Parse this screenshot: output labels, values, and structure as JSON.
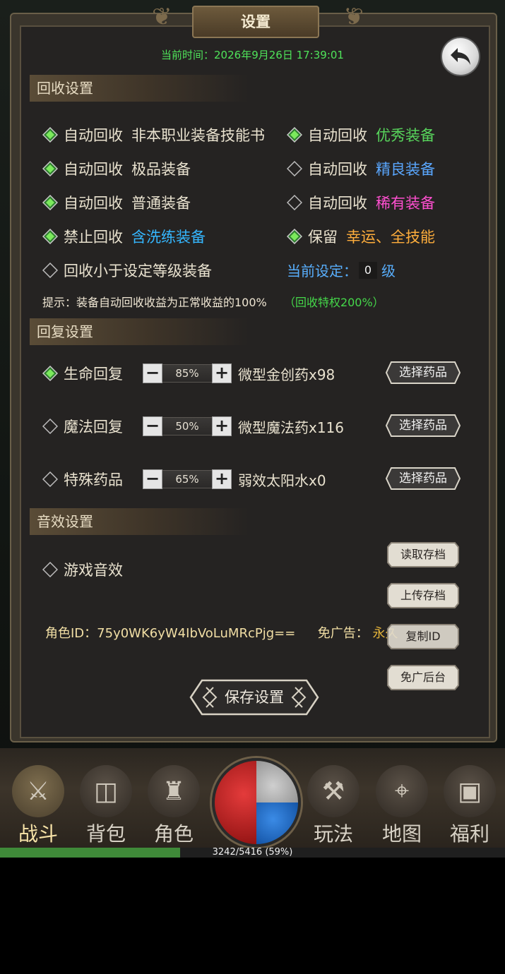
{
  "header": {
    "title": "设置",
    "current_time": "当前时间：2026年9月26日  17:39:01"
  },
  "recycle": {
    "section_title": "回收设置",
    "rows": [
      {
        "prefix": "自动回收",
        "item": "非本职业装备技能书",
        "checked": true,
        "color": "#e9e2cf"
      },
      {
        "prefix": "自动回收",
        "item": "优秀装备",
        "checked": true,
        "color": "#58d55c"
      },
      {
        "prefix": "自动回收",
        "item": "极品装备",
        "checked": true,
        "color": "#e9e2cf"
      },
      {
        "prefix": "自动回收",
        "item": "精良装备",
        "checked": false,
        "color": "#5aa7ff"
      },
      {
        "prefix": "自动回收",
        "item": "普通装备",
        "checked": true,
        "color": "#e9e2cf"
      },
      {
        "prefix": "自动回收",
        "item": "稀有装备",
        "checked": false,
        "color": "#ff4fd0"
      },
      {
        "prefix": "禁止回收",
        "item": "含洗练装备",
        "checked": true,
        "color": "#35b7ff"
      },
      {
        "prefix": "保留",
        "item": "幸运、全技能",
        "checked": true,
        "color": "#ffae3c"
      }
    ],
    "level_label": "回收小于设定等级装备",
    "level_checked": false,
    "current_setting_label": "当前设定：",
    "current_level": "0",
    "level_unit": "级",
    "hint": "提示：装备自动回收收益为正常收益的100%",
    "privilege": "（回收特权200%）"
  },
  "recovery": {
    "section_title": "回复设置",
    "rows": [
      {
        "label": "生命回复",
        "checked": true,
        "percent": "85%",
        "medicine": "微型金创药x98",
        "button": "选择药品"
      },
      {
        "label": "魔法回复",
        "checked": false,
        "percent": "50%",
        "medicine": "微型魔法药x116",
        "button": "选择药品"
      },
      {
        "label": "特殊药品",
        "checked": false,
        "percent": "65%",
        "medicine": "弱效太阳水x0",
        "button": "选择药品"
      }
    ]
  },
  "sound": {
    "section_title": "音效设置",
    "game_sound_label": "游戏音效",
    "game_sound_checked": false,
    "buttons": {
      "read": "读取存档",
      "upload": "上传存档",
      "copy_id": "复制ID",
      "ad_backend": "免广后台"
    },
    "role_id": "角色ID：75y0WK6yW4IbVoLuMRcPjg==",
    "ad_free_label": "免广告：",
    "ad_free_value": "永久"
  },
  "save_button": "保存设置",
  "bottom_nav": {
    "items": [
      {
        "label": "战斗",
        "icon": "crossed-swords-icon",
        "active": true
      },
      {
        "label": "背包",
        "icon": "backpack-icon",
        "active": false
      },
      {
        "label": "角色",
        "icon": "character-helmet-icon",
        "active": false
      },
      {
        "label": "玩法",
        "icon": "gameplay-icon",
        "active": false
      },
      {
        "label": "地图",
        "icon": "map-icon",
        "active": false
      },
      {
        "label": "福利",
        "icon": "treasure-chest-icon",
        "active": false
      }
    ]
  },
  "exp": {
    "text": "3242/5416 (59%)",
    "ratio": 0.59
  },
  "colors": {
    "accent_gold": "#f2dfa5",
    "time_green": "#4fe35a",
    "exp_green": "#3f8a39"
  }
}
